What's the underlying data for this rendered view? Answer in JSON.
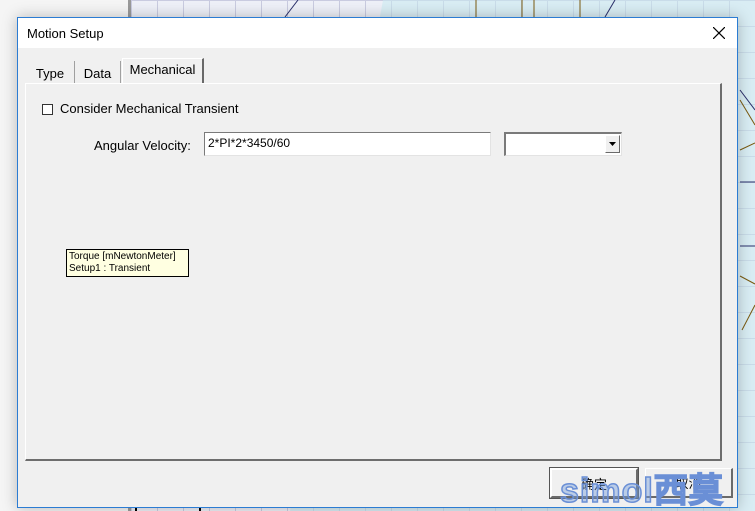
{
  "dialog": {
    "title": "Motion Setup",
    "close_icon": "close-icon"
  },
  "tabs": [
    {
      "label": "Type",
      "active": false
    },
    {
      "label": "Data",
      "active": false
    },
    {
      "label": "Mechanical",
      "active": true
    }
  ],
  "mechanical": {
    "consider_transient_label": "Consider Mechanical Transient",
    "consider_transient_checked": false,
    "angular_velocity_label": "Angular Velocity:",
    "angular_velocity_value": "2*PI*2*3450/60",
    "unit_value": ""
  },
  "tooltip": {
    "line1": "Torque [mNewtonMeter]",
    "line2": "Setup1 : Transient"
  },
  "buttons": {
    "ok_label": "确定",
    "cancel_label": "取消"
  },
  "watermark": "simol西莫"
}
